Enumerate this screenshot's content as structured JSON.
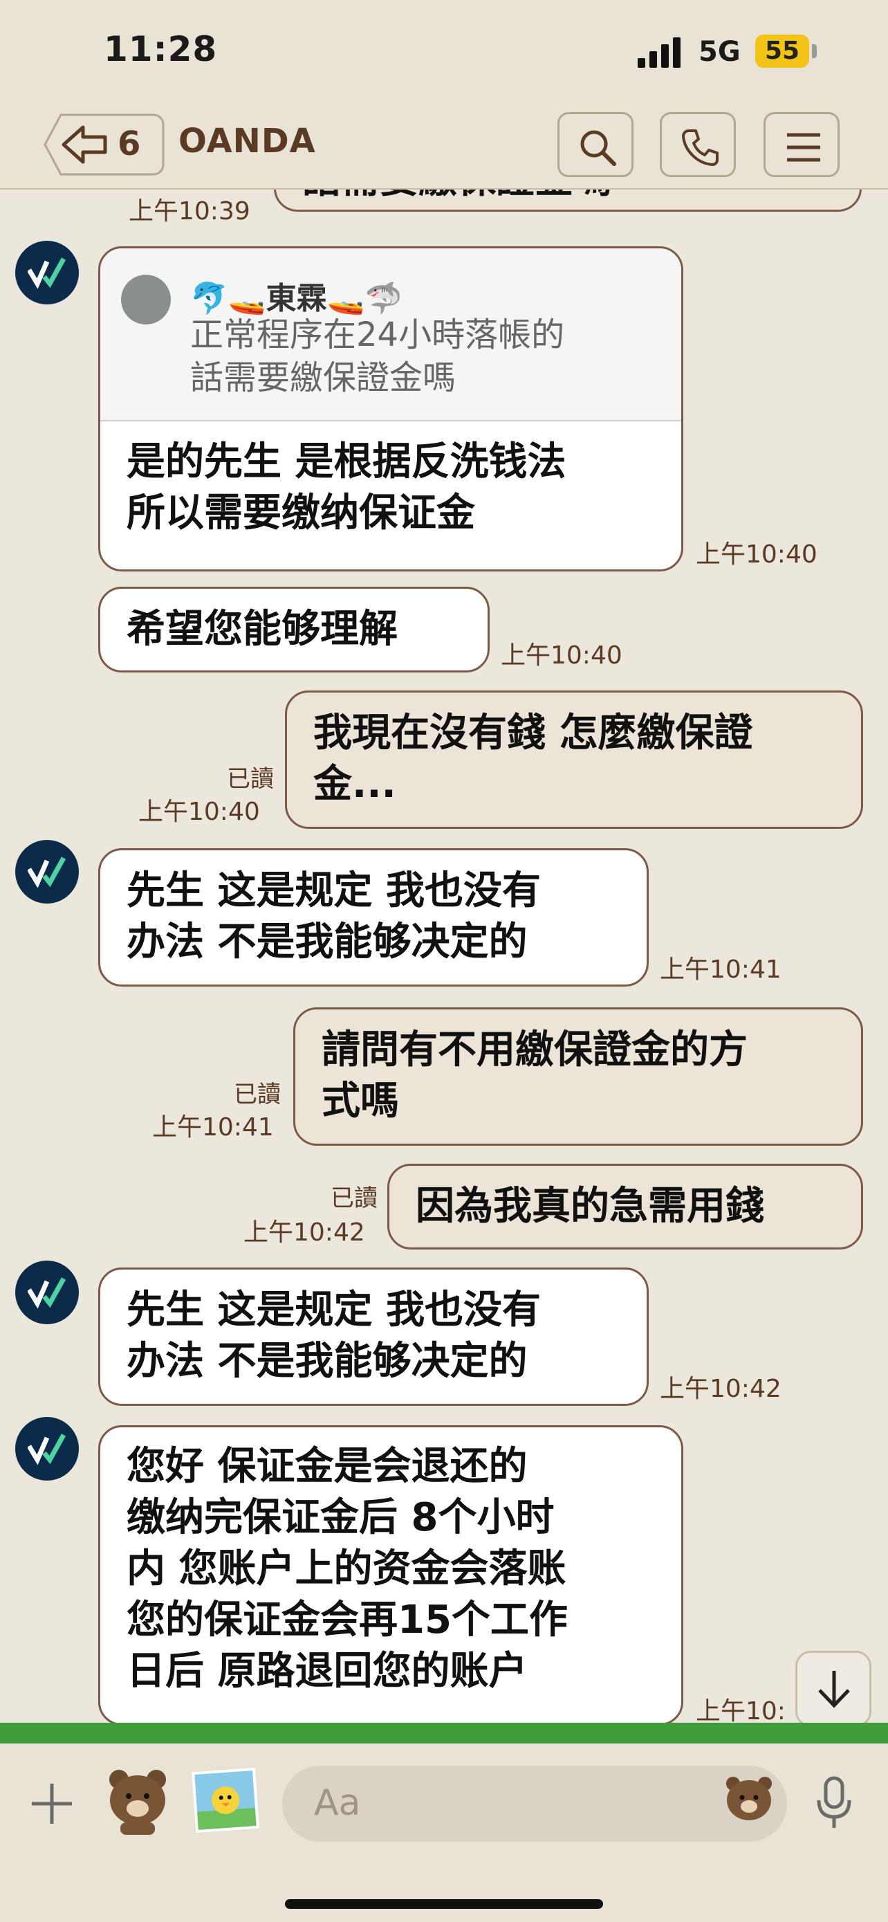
{
  "status": {
    "time": "11:28",
    "network": "5G",
    "battery": "55"
  },
  "header": {
    "back_count": "6",
    "title": "OANDA"
  },
  "messages": {
    "m0_time": "上午10:39",
    "m0_text": "話需要繳保證金嗎",
    "m1_quote_name": "🐬🚤東霖🚤🦈",
    "m1_quote_line1": "正常程序在24小時落帳的",
    "m1_quote_line2": "話需要繳保證金嗎",
    "m1_line1": "是的先生 是根据反洗钱法",
    "m1_line2": "所以需要缴纳保证金",
    "m1_time": "上午10:40",
    "m2_text": "希望您能够理解",
    "m2_time": "上午10:40",
    "m3_line1": "我現在沒有錢 怎麼繳保證",
    "m3_line2": "金...",
    "m3_read": "已讀",
    "m3_time": "上午10:40",
    "m4_line1": "先生  这是规定 我也没有",
    "m4_line2": "办法 不是我能够决定的",
    "m4_time": "上午10:41",
    "m5_line1": "請問有不用繳保證金的方",
    "m5_line2": "式嗎",
    "m5_read": "已讀",
    "m5_time": "上午10:41",
    "m6_text": "因為我真的急需用錢",
    "m6_read": "已讀",
    "m6_time": "上午10:42",
    "m7_line1": "先生  这是规定 我也没有",
    "m7_line2": "办法 不是我能够决定的",
    "m7_time": "上午10:42",
    "m8_line1": "您好 保证金是会退还的",
    "m8_line2": "缴纳完保证金后  8个小时",
    "m8_line3": "内  您账户上的资金会落账",
    "m8_line4": "您的保证金会再15个工作",
    "m8_line5": "日后 原路退回您的账户",
    "m8_time": "上午10:"
  },
  "composer": {
    "placeholder": "Aa"
  },
  "colors": {
    "background": "#ece7dc",
    "bubble_border": "#7d5a47",
    "accent_text": "#5a3a22",
    "avatar_bg": "#0c2a4a"
  },
  "icons": [
    "back-arrow-icon",
    "search-icon",
    "phone-icon",
    "menu-icon",
    "plus-icon",
    "sticker-icon",
    "photo-icon",
    "emoji-icon",
    "mic-icon",
    "scroll-down-icon"
  ]
}
